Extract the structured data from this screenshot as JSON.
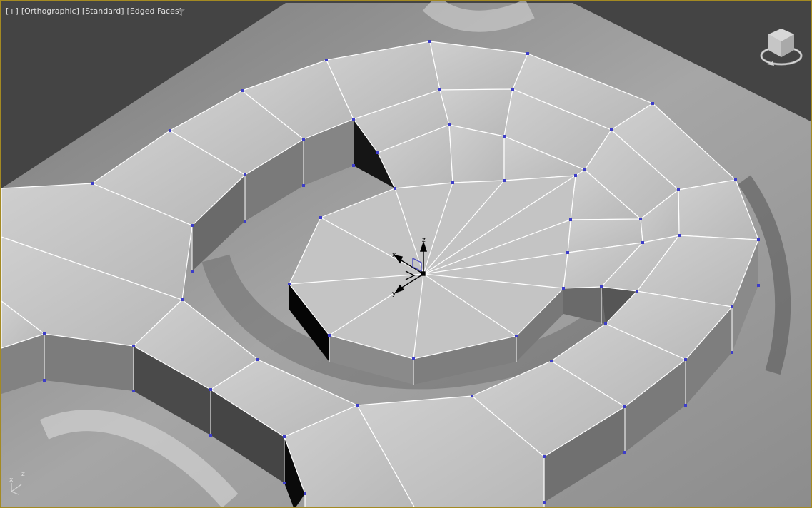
{
  "viewport": {
    "labels": {
      "plus": "[+]",
      "view": "[Orthographic]",
      "shading": "[Standard]",
      "edges": "[Edged Faces]"
    },
    "filter_icon": "funnel-icon",
    "gizmo": {
      "x": "x",
      "y": "y",
      "z": "z"
    },
    "tripod": {
      "x": "x",
      "z": "z"
    },
    "viewcube_icon": "viewcube-icon"
  },
  "colors": {
    "border": "#a48a22",
    "background": "#444444",
    "vertex": "#3d3dc8",
    "mesh_face": "#bebebe",
    "mesh_edge": "#ffffff"
  }
}
